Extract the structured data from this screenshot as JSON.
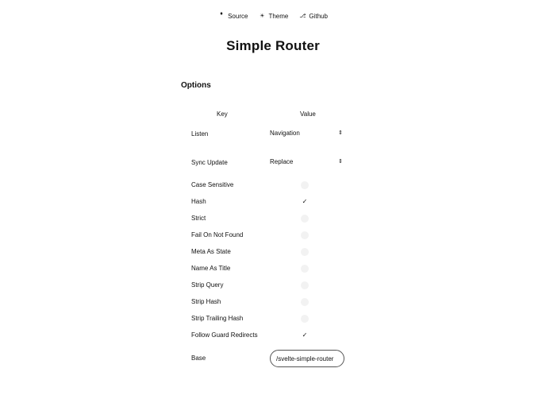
{
  "nav": {
    "links": [
      {
        "label": "Source",
        "icon": "github-fork-icon",
        "glyph": "♦"
      },
      {
        "label": "Theme",
        "icon": "sun-icon",
        "glyph": "☀"
      },
      {
        "label": "Github",
        "icon": "github-icon",
        "glyph": "⎇"
      }
    ]
  },
  "title": "Simple Router",
  "options": {
    "heading": "Options",
    "columns": {
      "key": "Key",
      "value": "Value"
    },
    "selects": [
      {
        "label": "Listen",
        "value": "Navigation",
        "chevron": "⌃⌄"
      },
      {
        "label": "Sync Update",
        "value": "Replace",
        "chevron": "⌃⌄"
      }
    ],
    "toggles": [
      {
        "label": "Case Sensitive",
        "checked": false
      },
      {
        "label": "Hash",
        "checked": true
      },
      {
        "label": "Strict",
        "checked": false
      },
      {
        "label": "Fail On Not Found",
        "checked": false
      },
      {
        "label": "Meta As State",
        "checked": false
      },
      {
        "label": "Name As Title",
        "checked": false
      },
      {
        "label": "Strip Query",
        "checked": false
      },
      {
        "label": "Strip Hash",
        "checked": false
      },
      {
        "label": "Strip Trailing Hash",
        "checked": false
      },
      {
        "label": "Follow Guard Redirects",
        "checked": true
      }
    ],
    "base": {
      "label": "Base",
      "value": "/svelte-simple-router"
    },
    "check_glyph": "✓"
  }
}
